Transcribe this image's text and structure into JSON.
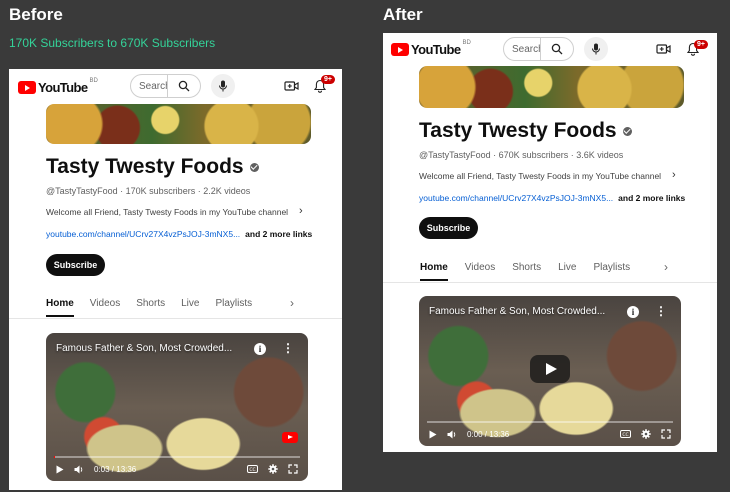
{
  "before": {
    "heading": "Before",
    "subtitle": "170K Subscribers to 670K Subscribers"
  },
  "after": {
    "heading": "After"
  },
  "panels": {
    "before": {
      "logo": {
        "wordmark": "YouTube",
        "country": "BD"
      },
      "search_placeholder": "Search",
      "notification_count": "9+",
      "channel_name": "Tasty Twesty Foods",
      "meta": "@TastyTastyFood · 170K subscribers · 2.2K videos",
      "description": "Welcome all Friend, Tasty Twesty Foods in my YouTube channel",
      "link_url": "youtube.com/channel/UCrv27X4vzPsJOJ-3mNX5...",
      "more_links": "and 2 more links",
      "subscribe": "Subscribe",
      "tabs": [
        "Home",
        "Videos",
        "Shorts",
        "Live",
        "Playlists"
      ],
      "video": {
        "title": "Famous Father & Son, Most Crowded...",
        "time": "0:03 / 13:36",
        "progress": 0.004
      }
    },
    "after": {
      "logo": {
        "wordmark": "YouTube",
        "country": "BD"
      },
      "search_placeholder": "Search",
      "notification_count": "9+",
      "channel_name": "Tasty Twesty Foods",
      "meta": "@TastyTastyFood · 670K subscribers · 3.6K videos",
      "description": "Welcome all Friend, Tasty Twesty Foods in my YouTube channel",
      "link_url": "youtube.com/channel/UCrv27X4vzPsJOJ-3mNX5...",
      "more_links": "and 2 more links",
      "subscribe": "Subscribe",
      "tabs": [
        "Home",
        "Videos",
        "Shorts",
        "Live",
        "Playlists"
      ],
      "video": {
        "title": "Famous Father & Son, Most Crowded...",
        "time": "0:00 / 13:36",
        "progress": 0
      }
    }
  },
  "colors": {
    "page_bg": "#3a3a3a",
    "accent_green": "#34d399",
    "youtube_red": "#ff0000",
    "link_blue": "#065fd4"
  }
}
